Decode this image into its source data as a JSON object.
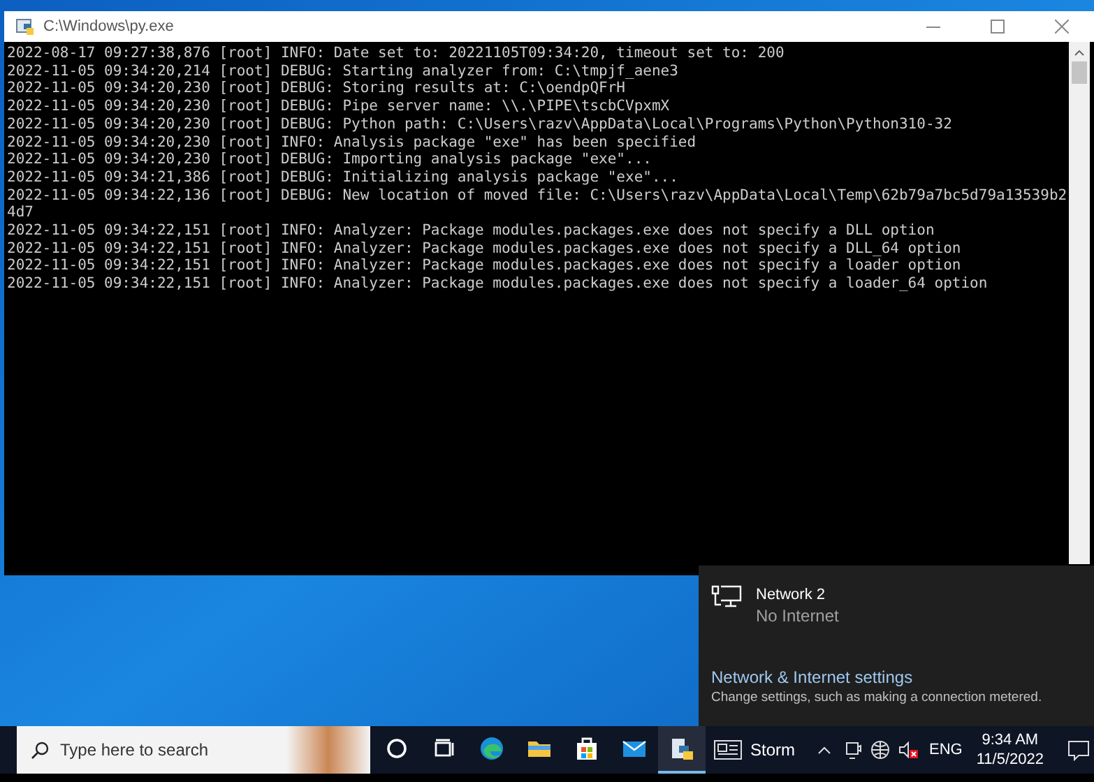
{
  "window": {
    "title": "C:\\Windows\\py.exe"
  },
  "console": {
    "lines": [
      "2022-08-17 09:27:38,876 [root] INFO: Date set to: 20221105T09:34:20, timeout set to: 200",
      "2022-11-05 09:34:20,214 [root] DEBUG: Starting analyzer from: C:\\tmpjf_aene3",
      "2022-11-05 09:34:20,230 [root] DEBUG: Storing results at: C:\\oendpQFrH",
      "2022-11-05 09:34:20,230 [root] DEBUG: Pipe server name: \\\\.\\PIPE\\tscbCVpxmX",
      "2022-11-05 09:34:20,230 [root] DEBUG: Python path: C:\\Users\\razv\\AppData\\Local\\Programs\\Python\\Python310-32",
      "2022-11-05 09:34:20,230 [root] INFO: Analysis package \"exe\" has been specified",
      "2022-11-05 09:34:20,230 [root] DEBUG: Importing analysis package \"exe\"...",
      "2022-11-05 09:34:21,386 [root] DEBUG: Initializing analysis package \"exe\"...",
      "2022-11-05 09:34:22,136 [root] DEBUG: New location of moved file: C:\\Users\\razv\\AppData\\Local\\Temp\\62b79a7bc5d79a13539b24d7",
      "2022-11-05 09:34:22,151 [root] INFO: Analyzer: Package modules.packages.exe does not specify a DLL option",
      "2022-11-05 09:34:22,151 [root] INFO: Analyzer: Package modules.packages.exe does not specify a DLL_64 option",
      "2022-11-05 09:34:22,151 [root] INFO: Analyzer: Package modules.packages.exe does not specify a loader option",
      "2022-11-05 09:34:22,151 [root] INFO: Analyzer: Package modules.packages.exe does not specify a loader_64 option"
    ]
  },
  "network_flyout": {
    "name": "Network 2",
    "status": "No Internet",
    "settings_link": "Network & Internet settings",
    "settings_description": "Change settings, such as making a connection metered."
  },
  "taskbar": {
    "search": {
      "placeholder": "Type here to search"
    },
    "apps": [
      {
        "kind": "cortana",
        "active": false
      },
      {
        "kind": "taskview",
        "active": false
      },
      {
        "kind": "edge",
        "active": false
      },
      {
        "kind": "explorer",
        "active": false
      },
      {
        "kind": "store",
        "active": false
      },
      {
        "kind": "mail",
        "active": false
      },
      {
        "kind": "python",
        "active": true
      }
    ],
    "weather": "Storm",
    "language": "ENG",
    "time": "9:34 AM",
    "date": "11/5/2022"
  }
}
